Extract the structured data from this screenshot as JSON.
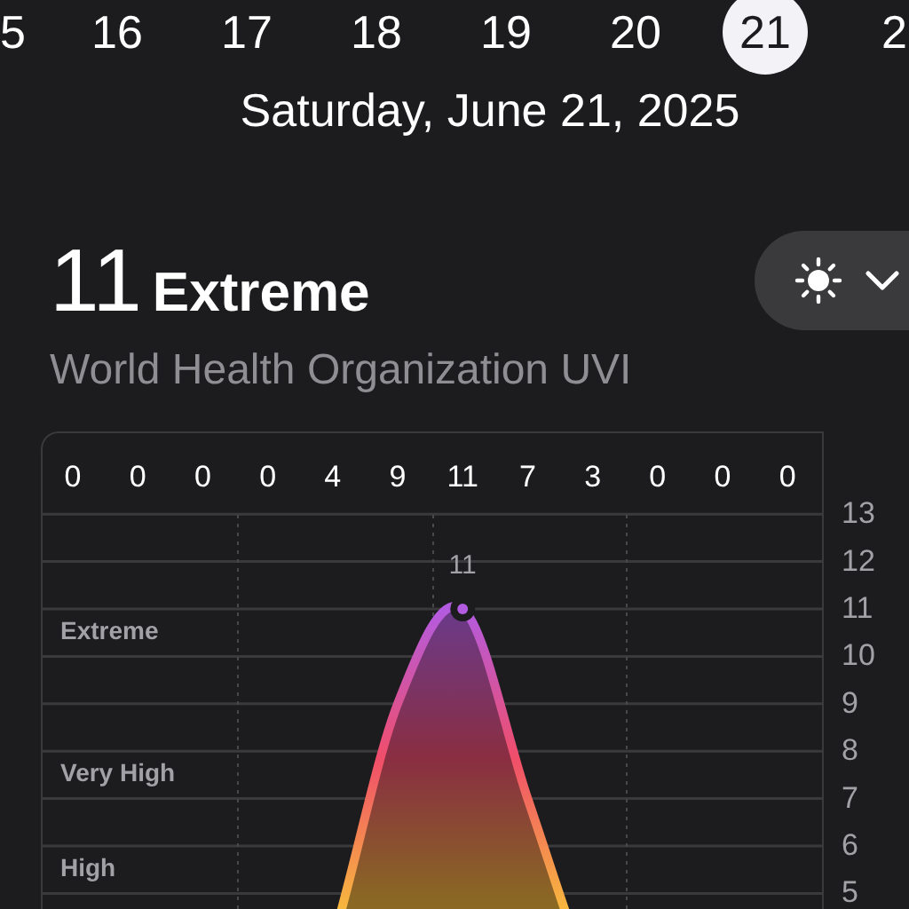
{
  "days": [
    {
      "label": "5",
      "selected": false
    },
    {
      "label": "16",
      "selected": false
    },
    {
      "label": "17",
      "selected": false
    },
    {
      "label": "18",
      "selected": false
    },
    {
      "label": "19",
      "selected": false
    },
    {
      "label": "20",
      "selected": false
    },
    {
      "label": "21",
      "selected": true
    },
    {
      "label": "2",
      "selected": false
    }
  ],
  "date": "Saturday, June 21, 2025",
  "uv": {
    "value": "11",
    "category": "Extreme",
    "source": "World Health Organization UVI"
  },
  "chart": {
    "hourly_values": [
      "0",
      "0",
      "0",
      "0",
      "4",
      "9",
      "11",
      "7",
      "3",
      "0",
      "0",
      "0"
    ],
    "peak_label": "11",
    "zones": [
      {
        "label": "Extreme"
      },
      {
        "label": "Very High"
      },
      {
        "label": "High"
      }
    ],
    "chart_data": {
      "type": "area",
      "series": [
        {
          "color": "#b35be0",
          "values": [
            0,
            0,
            0,
            0,
            4,
            9,
            11,
            7,
            3,
            0,
            0,
            0
          ]
        }
      ],
      "ylim": [
        0,
        13
      ],
      "yticks": [
        5,
        6,
        7,
        8,
        9,
        10,
        11,
        12,
        13
      ],
      "grid": true
    }
  }
}
